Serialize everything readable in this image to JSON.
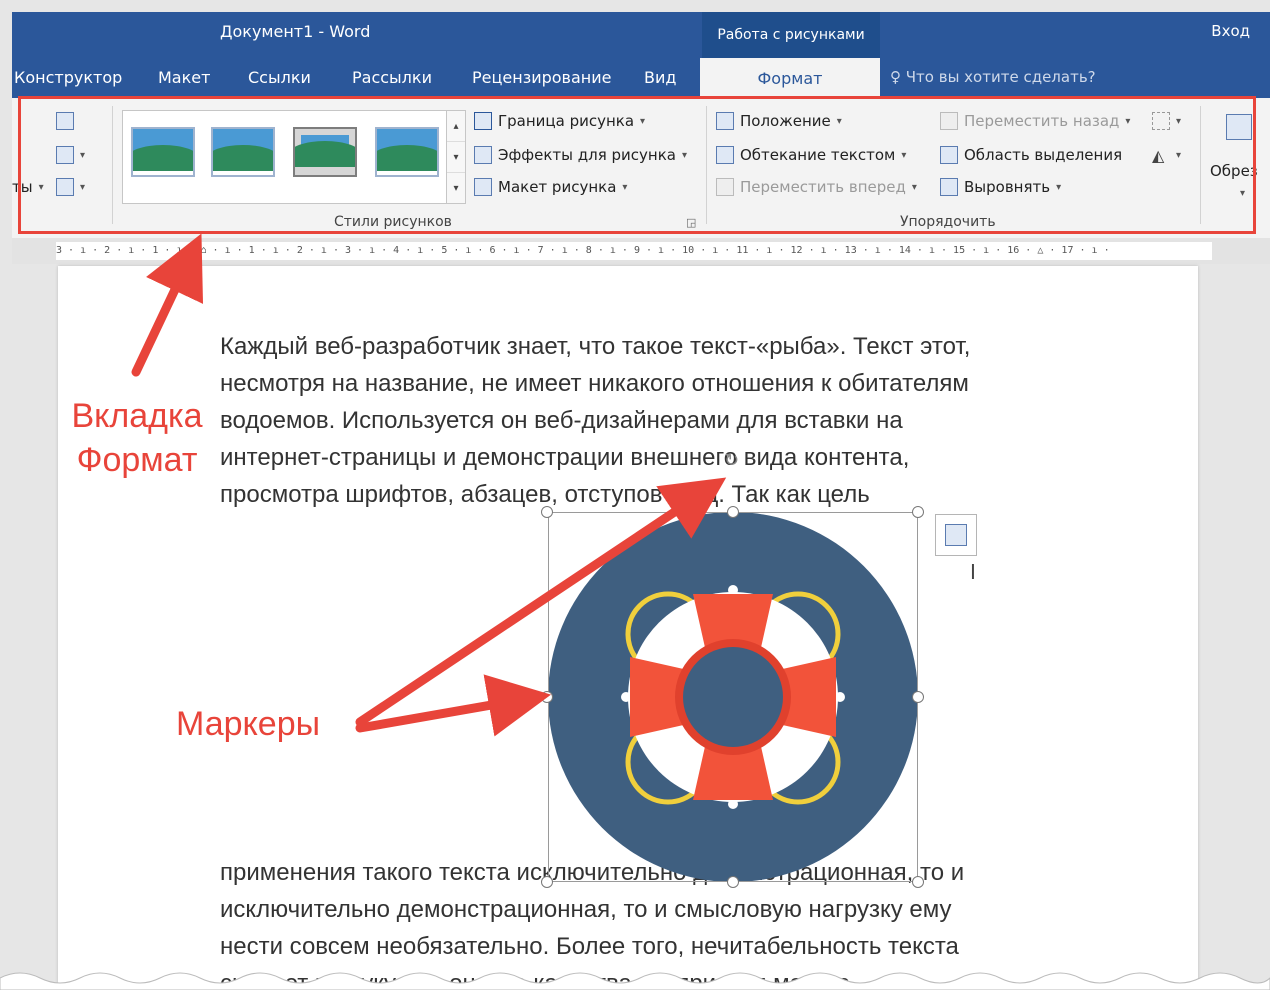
{
  "app": {
    "doc_title": "Документ1  -  Word",
    "contextual_header": "Работа с рисунками",
    "signin": "Вход"
  },
  "tabs": [
    {
      "label": "Конструктор"
    },
    {
      "label": "Макет"
    },
    {
      "label": "Ссылки"
    },
    {
      "label": "Рассылки"
    },
    {
      "label": "Рецензирование"
    },
    {
      "label": "Вид"
    }
  ],
  "active_tab": "Формат",
  "tell_me": "Что вы хотите сделать?",
  "ribbon": {
    "left_partial": "ты",
    "picture_styles": {
      "border": "Граница рисунка",
      "effects": "Эффекты для рисунка",
      "layout": "Макет рисунка",
      "group_label": "Стили рисунков"
    },
    "arrange": {
      "position": "Положение",
      "wrap": "Обтекание текстом",
      "bring_forward": "Переместить вперед",
      "send_backward": "Переместить назад",
      "selection_pane": "Область выделения",
      "align": "Выровнять",
      "group_label": "Упорядочить"
    },
    "crop": "Обрез"
  },
  "ruler_text": "3 · ı · 2 · ı · 1 · ı · ⌂ · ı · 1 · ı · 2 · ı · 3 · ı · 4 · ı · 5 · ı · 6 · ı · 7 · ı · 8 · ı · 9 · ı · 10 · ı · 11 · ı · 12 · ı · 13 · ı · 14 · ı · 15 · ı · 16 · △ · 17 · ı ·",
  "document": {
    "para1_lines": [
      "Каждый веб-разработчик знает, что такое текст-«рыба». Текст этот,",
      "несмотря на название, не имеет никакого отношения к обитателям",
      "водоемов. Используется он веб-дизайнерами для вставки на",
      "интернет-страницы и демонстрации внешнего вида контента,",
      "просмотра шрифтов, абзацев, отступов и т.д. Так как цель"
    ],
    "para2_lines": [
      "применения такого текста исключительно демонстрационная, то и",
      "исключительно демонстрационная, то и смысловую нагрузку ему",
      "нести совсем необязательно. Более того, нечитабельность текста",
      "сыграет на руку при оценке качества восприятия макета."
    ]
  },
  "annotations": {
    "format_tab_line1": "Вкладка",
    "format_tab_line2": "Формат",
    "handles": "Маркеры"
  },
  "colors": {
    "word_blue": "#2b579a",
    "accent_red": "#e8443a",
    "ring_dark": "#3f5f80",
    "buoy_red": "#f2533a",
    "rope": "#f0cf3c"
  }
}
